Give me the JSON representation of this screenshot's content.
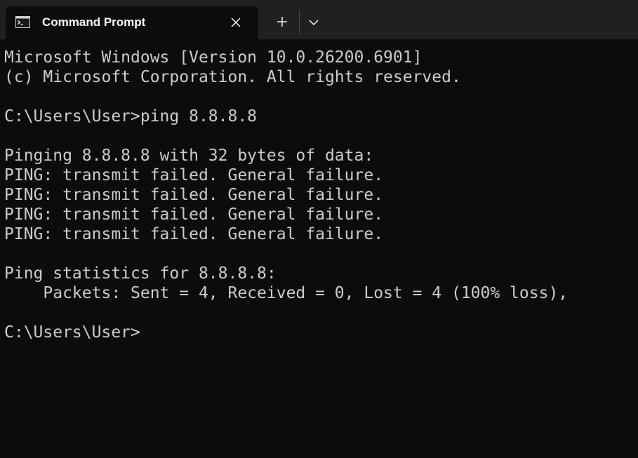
{
  "tab": {
    "title": "Command Prompt",
    "icon": "cmd-icon",
    "close_icon": "close-icon"
  },
  "toolbar": {
    "new_tab_icon": "plus-icon",
    "dropdown_icon": "chevron-down-icon"
  },
  "console": {
    "lines": [
      "Microsoft Windows [Version 10.0.26200.6901]",
      "(c) Microsoft Corporation. All rights reserved.",
      "",
      "C:\\Users\\User>ping 8.8.8.8",
      "",
      "Pinging 8.8.8.8 with 32 bytes of data:",
      "PING: transmit failed. General failure.",
      "PING: transmit failed. General failure.",
      "PING: transmit failed. General failure.",
      "PING: transmit failed. General failure.",
      "",
      "Ping statistics for 8.8.8.8:",
      "    Packets: Sent = 4, Received = 0, Lost = 4 (100% loss),",
      "",
      "C:\\Users\\User>"
    ]
  },
  "colors": {
    "titlebar": "#202020",
    "background": "#0c0c0c",
    "text": "#cccccc"
  }
}
